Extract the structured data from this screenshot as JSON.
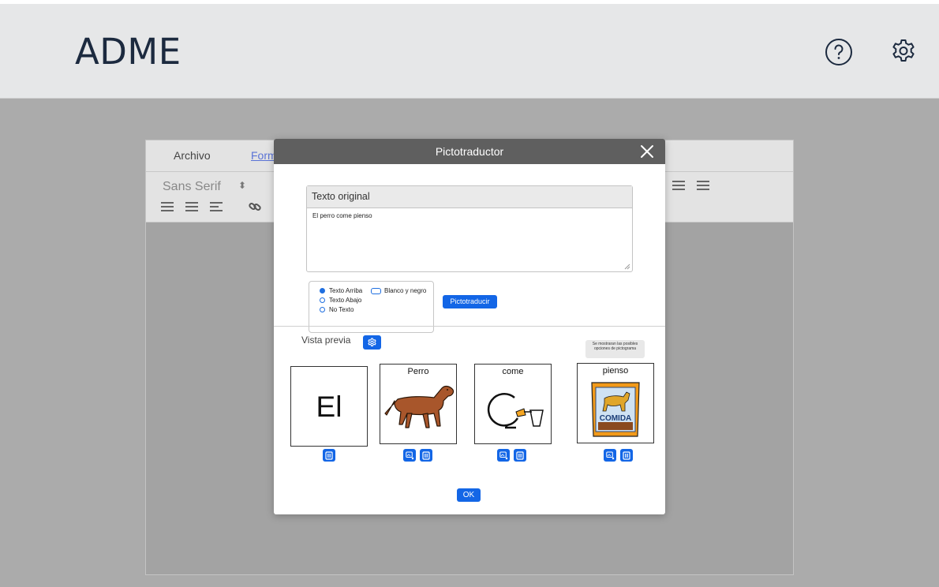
{
  "app": {
    "brand": "ADME"
  },
  "header": {
    "help_icon": "help-circle-icon",
    "settings_icon": "gear-icon"
  },
  "editor": {
    "menu": {
      "archivo": "Archivo",
      "formato": "Form"
    },
    "toolbar": {
      "font": "Sans Serif",
      "font_caret": "⬍"
    }
  },
  "modal": {
    "title": "Pictotraductor",
    "original": {
      "heading": "Texto original",
      "text": "El perro come pienso"
    },
    "options": {
      "texto_arriba": "Texto Arriba",
      "texto_abajo": "Texto Abajo",
      "no_texto": "No Texto",
      "blanco_negro": "Blanco y negro",
      "selected": "Texto Arriba"
    },
    "translate_button": "Pictotraducir",
    "preview_label": "Vista previa",
    "tooltip": "Se mostraran las posibles opciones de pictograma",
    "cards": [
      {
        "label": "",
        "big_text": "El",
        "image": "none"
      },
      {
        "label": "Perro",
        "big_text": "",
        "image": "dog-pictogram"
      },
      {
        "label": "come",
        "big_text": "",
        "image": "eating-pictogram"
      },
      {
        "label": "pienso",
        "big_text": "",
        "image": "dog-food-bag-pictogram",
        "bag_text": "COMIDA"
      }
    ],
    "ok_button": "OK"
  },
  "colors": {
    "accent": "#1366e6",
    "header_bg": "#e6e7e8",
    "modal_header": "#5f5f5f",
    "brand_text": "#1c2a3f"
  }
}
